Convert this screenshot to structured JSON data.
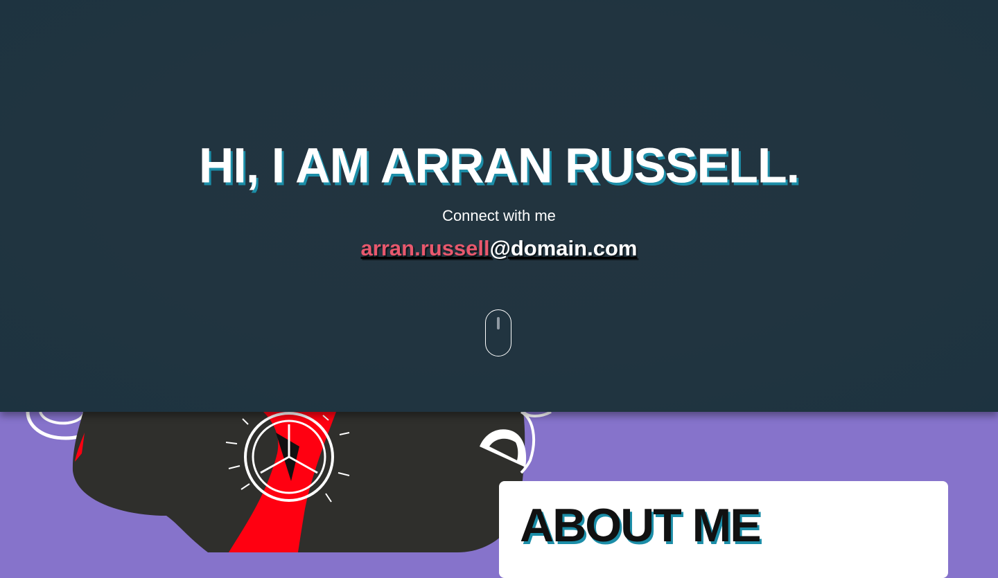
{
  "hero": {
    "title": "Hi, I am Arran Russell.",
    "connect_label": "Connect with me",
    "email_user": "arran.russell",
    "email_domain": "@domain.com",
    "scroll_icon": "mouse-scroll-icon"
  },
  "about": {
    "title": "About me"
  },
  "colors": {
    "hero_bg": "#213440",
    "accent_shadow": "#1c8ea8",
    "email_user": "#e8586d",
    "section_bg": "#8673cb",
    "card_bg": "#ffffff"
  }
}
